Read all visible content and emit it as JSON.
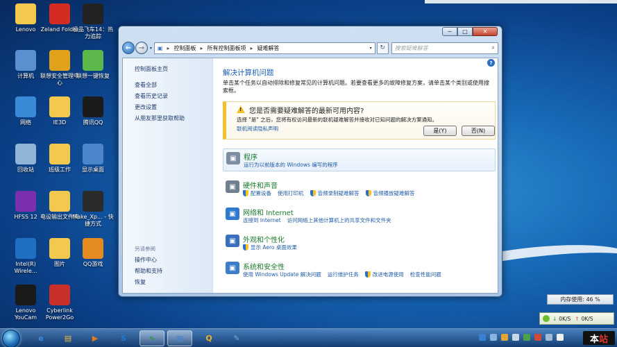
{
  "desktop": {
    "icons": [
      {
        "label": "Lenovo",
        "icon": "folder-icon",
        "color": "#f2c94c"
      },
      {
        "label": "Zeland Folder",
        "icon": "zeland-icon",
        "color": "#d62b22"
      },
      {
        "label": "极品飞车14：热力追踪",
        "icon": "racing-game-icon",
        "color": "#222222"
      },
      {
        "label": "计算机",
        "icon": "computer-icon",
        "color": "#5a8fd0"
      },
      {
        "label": "联想安全管理中心",
        "icon": "security-shield-icon",
        "color": "#e0a21b"
      },
      {
        "label": "联想一键恢复",
        "icon": "recovery-icon",
        "color": "#5cb84a"
      },
      {
        "label": "网络",
        "icon": "network-icon",
        "color": "#3a8ad8"
      },
      {
        "label": "IE3D",
        "icon": "folder-icon",
        "color": "#f2c94c"
      },
      {
        "label": "腾讯QQ",
        "icon": "qq-penguin-icon",
        "color": "#1b1b1b"
      },
      {
        "label": "回收站",
        "icon": "recycle-bin-icon",
        "color": "#8fb4d8"
      },
      {
        "label": "班级工作",
        "icon": "folder-icon",
        "color": "#f2c94c"
      },
      {
        "label": "显示桌面",
        "icon": "show-desktop-icon",
        "color": "#4a86c9"
      },
      {
        "label": "HFSS 12",
        "icon": "hfss-icon",
        "color": "#7a2fb0"
      },
      {
        "label": "电设输出文件夹",
        "icon": "folder-icon",
        "color": "#f2c94c"
      },
      {
        "label": "Make_Xp... - 快捷方式",
        "icon": "oscilloscope-icon",
        "color": "#2b2b2b"
      },
      {
        "label": "Intel(R) Wirele...",
        "icon": "wireless-icon",
        "color": "#1f6fc2"
      },
      {
        "label": "图片",
        "icon": "folder-icon",
        "color": "#f2c94c"
      },
      {
        "label": "QQ游戏",
        "icon": "qq-game-icon",
        "color": "#e58a1f"
      },
      {
        "label": "Lenovo YouCam",
        "icon": "webcam-icon",
        "color": "#1a1a1a"
      },
      {
        "label": "Cyberlink Power2Go",
        "icon": "power2go-icon",
        "color": "#c9302c"
      }
    ]
  },
  "window": {
    "controls": {
      "minimize": "─",
      "maximize": "□",
      "close": "✕"
    },
    "nav": {
      "back": "←",
      "forward": "→",
      "dropdown": "▾"
    },
    "address": {
      "segments": [
        "控制面板",
        "所有控制面板项",
        "疑难解答"
      ],
      "separator": "▸",
      "dropdown": "▾",
      "refresh": "↻"
    },
    "search": {
      "placeholder": "搜索疑难解答",
      "icon": "⌕"
    },
    "sidebar": {
      "home": "控制面板主页",
      "links": [
        "查看全部",
        "查看历史记录",
        "更改设置",
        "从朋友那里获取帮助"
      ],
      "see_also_title": "另请参阅",
      "see_also": [
        "操作中心",
        "帮助和支持",
        "恢复"
      ]
    },
    "help": "?",
    "main": {
      "title": "解决计算机问题",
      "description": "单击某个任务以自动排除和修复常见的计算机问题。若要查看更多的故障修复方案，请单击某个类别或使用搜索框。",
      "banner": {
        "warn": "!",
        "title": "您是否需要疑难解答的最新可用内容?",
        "text": "选择 \"是\" 之后，您将有权访问最新的联机疑难解答并接收对已知问题的解决方案通知。",
        "link": "联机阅读隐私声明",
        "yes": "是(Y)",
        "no": "否(N)"
      },
      "categories": [
        {
          "title": "程序",
          "icon": "programs-icon",
          "color": "#7d8ea3",
          "links": [
            {
              "text": "运行为以前版本的 Windows 编写的程序",
              "shield": false
            }
          ]
        },
        {
          "title": "硬件和声音",
          "icon": "hardware-sound-icon",
          "color": "#6f7f8f",
          "links": [
            {
              "text": "配置设备",
              "shield": true
            },
            {
              "text": "使用打印机",
              "shield": false
            },
            {
              "text": "音频录制疑难解答",
              "shield": true
            },
            {
              "text": "音频播放疑难解答",
              "shield": true
            }
          ]
        },
        {
          "title": "网络和 Internet",
          "icon": "network-internet-icon",
          "color": "#2f7ad0",
          "links": [
            {
              "text": "连接到 Internet",
              "shield": false
            },
            {
              "text": "访问网络上其他计算机上的共享文件和文件夹",
              "shield": false
            }
          ]
        },
        {
          "title": "外观和个性化",
          "icon": "appearance-icon",
          "color": "#3a6fc0",
          "links": [
            {
              "text": "显示 Aero 桌面效果",
              "shield": true
            }
          ]
        },
        {
          "title": "系统和安全性",
          "icon": "system-security-icon",
          "color": "#3c7ec9",
          "links": [
            {
              "text": "使用 Windows Update 解决问题",
              "shield": false
            },
            {
              "text": "运行维护任务",
              "shield": false
            },
            {
              "text": "改进电源使用",
              "shield": true
            },
            {
              "text": "检查性能问题",
              "shield": false
            }
          ]
        }
      ]
    }
  },
  "widgets": {
    "memory": "内存使用: 46 %",
    "net": {
      "down_arrow": "↓",
      "up_arrow": "↑",
      "down": "0K/S",
      "up": "0K/S"
    }
  },
  "taskbar": {
    "buttons": [
      {
        "icon": "ie-browser-icon",
        "glyph": "e",
        "color": "#3c8be0",
        "active": false
      },
      {
        "icon": "explorer-folder-icon",
        "glyph": "▤",
        "color": "#e6b84a",
        "active": false
      },
      {
        "icon": "media-player-icon",
        "glyph": "▶",
        "color": "#e27c22",
        "active": false
      },
      {
        "icon": "sogou-icon",
        "glyph": "S",
        "color": "#1e7ad4",
        "active": false
      },
      {
        "icon": "monitor-icon",
        "glyph": "∿",
        "color": "#2b9a3c",
        "active": true
      },
      {
        "icon": "control-panel-icon",
        "glyph": "▦",
        "color": "#4a86c9",
        "active": true
      },
      {
        "icon": "qq-taskbar-icon",
        "glyph": "Q",
        "color": "#f2b01e",
        "active": false
      },
      {
        "icon": "tools-icon",
        "glyph": "✎",
        "color": "#7aa6d6",
        "active": false
      }
    ],
    "logo_left": "本",
    "logo_right": "站"
  }
}
